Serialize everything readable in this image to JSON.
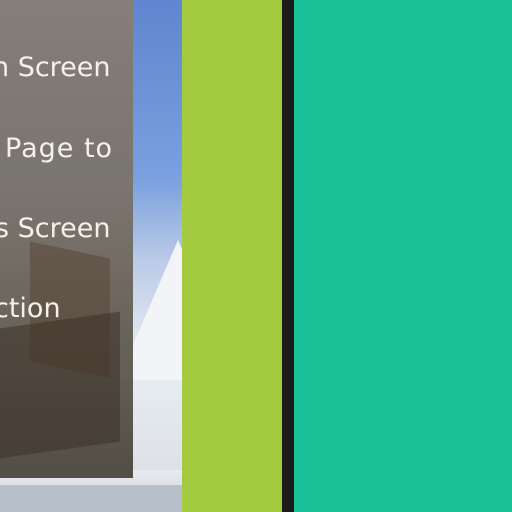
{
  "menu": {
    "items": [
      {
        "label": "n Screen"
      },
      {
        "label": "Page to"
      },
      {
        "label": "s Screen"
      },
      {
        "label": "ction"
      }
    ]
  },
  "colors": {
    "lime_panel": "#a4cb40",
    "teal_panel": "#18c296",
    "divider": "#1b1b1b",
    "menu_text": "#f4f1ea"
  }
}
